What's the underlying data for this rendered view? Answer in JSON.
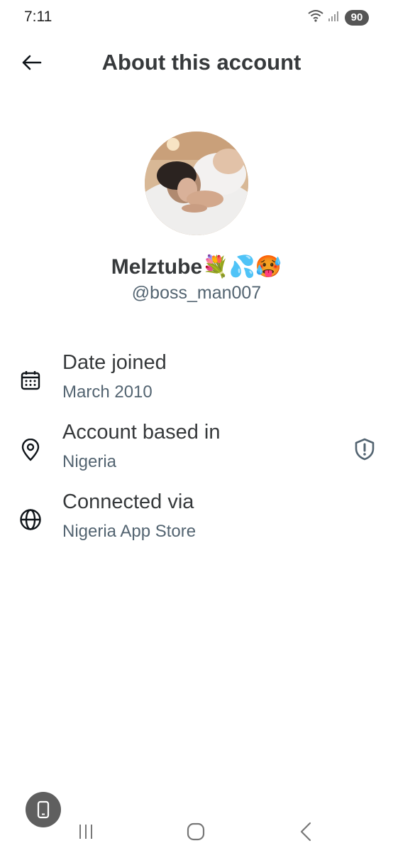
{
  "status_bar": {
    "time": "7:11",
    "battery": "90",
    "icons": [
      "wifi-icon",
      "signal-icon"
    ]
  },
  "header": {
    "title": "About this account",
    "back_icon": "arrow-left-icon"
  },
  "profile": {
    "display_name": "Melztube💐💦🥵",
    "handle": "@boss_man007"
  },
  "info_rows": [
    {
      "icon": "calendar-icon",
      "title": "Date joined",
      "value": "March 2010"
    },
    {
      "icon": "location-pin-icon",
      "title": "Account based in",
      "value": "Nigeria",
      "trailing_icon": "shield-alert-icon"
    },
    {
      "icon": "globe-icon",
      "title": "Connected via",
      "value": "Nigeria App Store"
    }
  ],
  "nav_bar": {
    "buttons": [
      "recent-apps-icon",
      "home-icon",
      "back-icon"
    ]
  },
  "colors": {
    "text_primary": "#36393b",
    "text_secondary": "#536471",
    "background": "#ffffff"
  }
}
